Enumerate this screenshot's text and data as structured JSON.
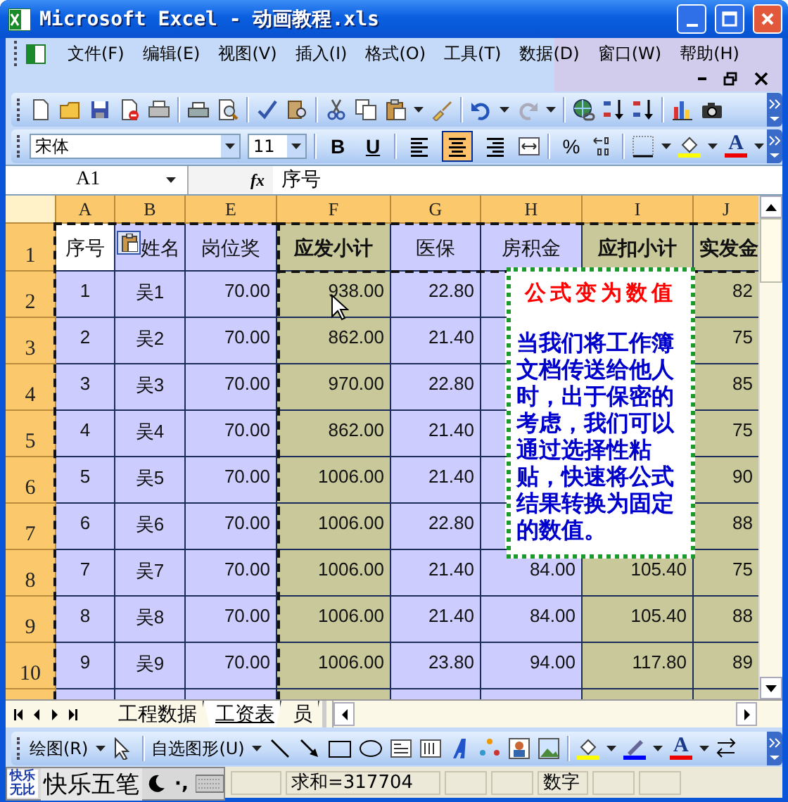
{
  "window": {
    "title": "Microsoft Excel - 动画教程.xls"
  },
  "menu": [
    {
      "label": "文件(F)"
    },
    {
      "label": "编辑(E)"
    },
    {
      "label": "视图(V)"
    },
    {
      "label": "插入(I)"
    },
    {
      "label": "格式(O)"
    },
    {
      "label": "工具(T)"
    },
    {
      "label": "数据(D)"
    },
    {
      "label": "窗口(W)"
    },
    {
      "label": "帮助(H)"
    }
  ],
  "formatting": {
    "font": "宋体",
    "size": "11",
    "bold": "B",
    "underline": "U",
    "align": [
      {
        "selected": false
      },
      {
        "selected": true
      },
      {
        "selected": false
      }
    ],
    "percent": "%",
    "font_color": "A"
  },
  "formula_bar": {
    "name_box": "A1",
    "fx": "fx",
    "value": "序号"
  },
  "sheet": {
    "columns": [
      {
        "label": "A",
        "kind": "text"
      },
      {
        "label": "B",
        "kind": "text"
      },
      {
        "label": "E",
        "kind": "number"
      },
      {
        "label": "F",
        "kind": "subtotal"
      },
      {
        "label": "G",
        "kind": "number"
      },
      {
        "label": "H",
        "kind": "number"
      },
      {
        "label": "I",
        "kind": "subtotal"
      },
      {
        "label": "J",
        "kind": "subtotal"
      }
    ],
    "header_row": {
      "number": "1",
      "cells": [
        {
          "text": "序号",
          "selected": true
        },
        {
          "text": "姓名",
          "selected": false
        },
        {
          "text": "岗位奖",
          "selected": false
        },
        {
          "text": "应发小计",
          "selected": false
        },
        {
          "text": "医保",
          "selected": false
        },
        {
          "text": "房积金",
          "selected": false
        },
        {
          "text": "应扣小计",
          "selected": false
        },
        {
          "text": "实发金",
          "selected": false
        }
      ]
    },
    "rows": [
      {
        "number": "2",
        "cells": [
          "1",
          "吴1",
          "70.00",
          "938.00",
          "22.80",
          null,
          null,
          "82"
        ]
      },
      {
        "number": "3",
        "cells": [
          "2",
          "吴2",
          "70.00",
          "862.00",
          "21.40",
          null,
          null,
          "75"
        ]
      },
      {
        "number": "4",
        "cells": [
          "3",
          "吴3",
          "70.00",
          "970.00",
          "22.80",
          null,
          null,
          "85"
        ]
      },
      {
        "number": "5",
        "cells": [
          "4",
          "吴4",
          "70.00",
          "862.00",
          "21.40",
          null,
          null,
          "75"
        ]
      },
      {
        "number": "6",
        "cells": [
          "5",
          "吴5",
          "70.00",
          "1006.00",
          "21.40",
          null,
          null,
          "90"
        ]
      },
      {
        "number": "7",
        "cells": [
          "6",
          "吴6",
          "70.00",
          "1006.00",
          "22.80",
          null,
          null,
          "88"
        ]
      },
      {
        "number": "8",
        "cells": [
          "7",
          "吴7",
          "70.00",
          "1006.00",
          "21.40",
          "84.00",
          "105.40",
          "75"
        ]
      },
      {
        "number": "9",
        "cells": [
          "8",
          "吴8",
          "70.00",
          "1006.00",
          "21.40",
          "84.00",
          "105.40",
          "88"
        ]
      },
      {
        "number": "10",
        "cells": [
          "9",
          "吴9",
          "70.00",
          "1006.00",
          "23.80",
          "94.00",
          "117.80",
          "89"
        ]
      }
    ],
    "text_box": {
      "title": "公式变为数值",
      "body": "当我们将工作簿文档传送给他人时，出于保密的考虑，我们可以通过选择性粘贴，快速将公式结果转换为固定的数值。"
    }
  },
  "sheet_tabs": [
    {
      "label": "工程数据",
      "selected": false
    },
    {
      "label": "工资表",
      "selected": true
    },
    {
      "label": "员",
      "selected": false
    }
  ],
  "drawing_toolbar": {
    "draw": "绘图(R)",
    "autoshapes": "自选图形(U)",
    "font_color": "A"
  },
  "ime": {
    "logo": [
      "快乐",
      "无比"
    ],
    "name": "快乐五笔",
    "punctuation": "·,"
  },
  "status_bar": {
    "sum": "求和=317704",
    "mode": "数字"
  }
}
